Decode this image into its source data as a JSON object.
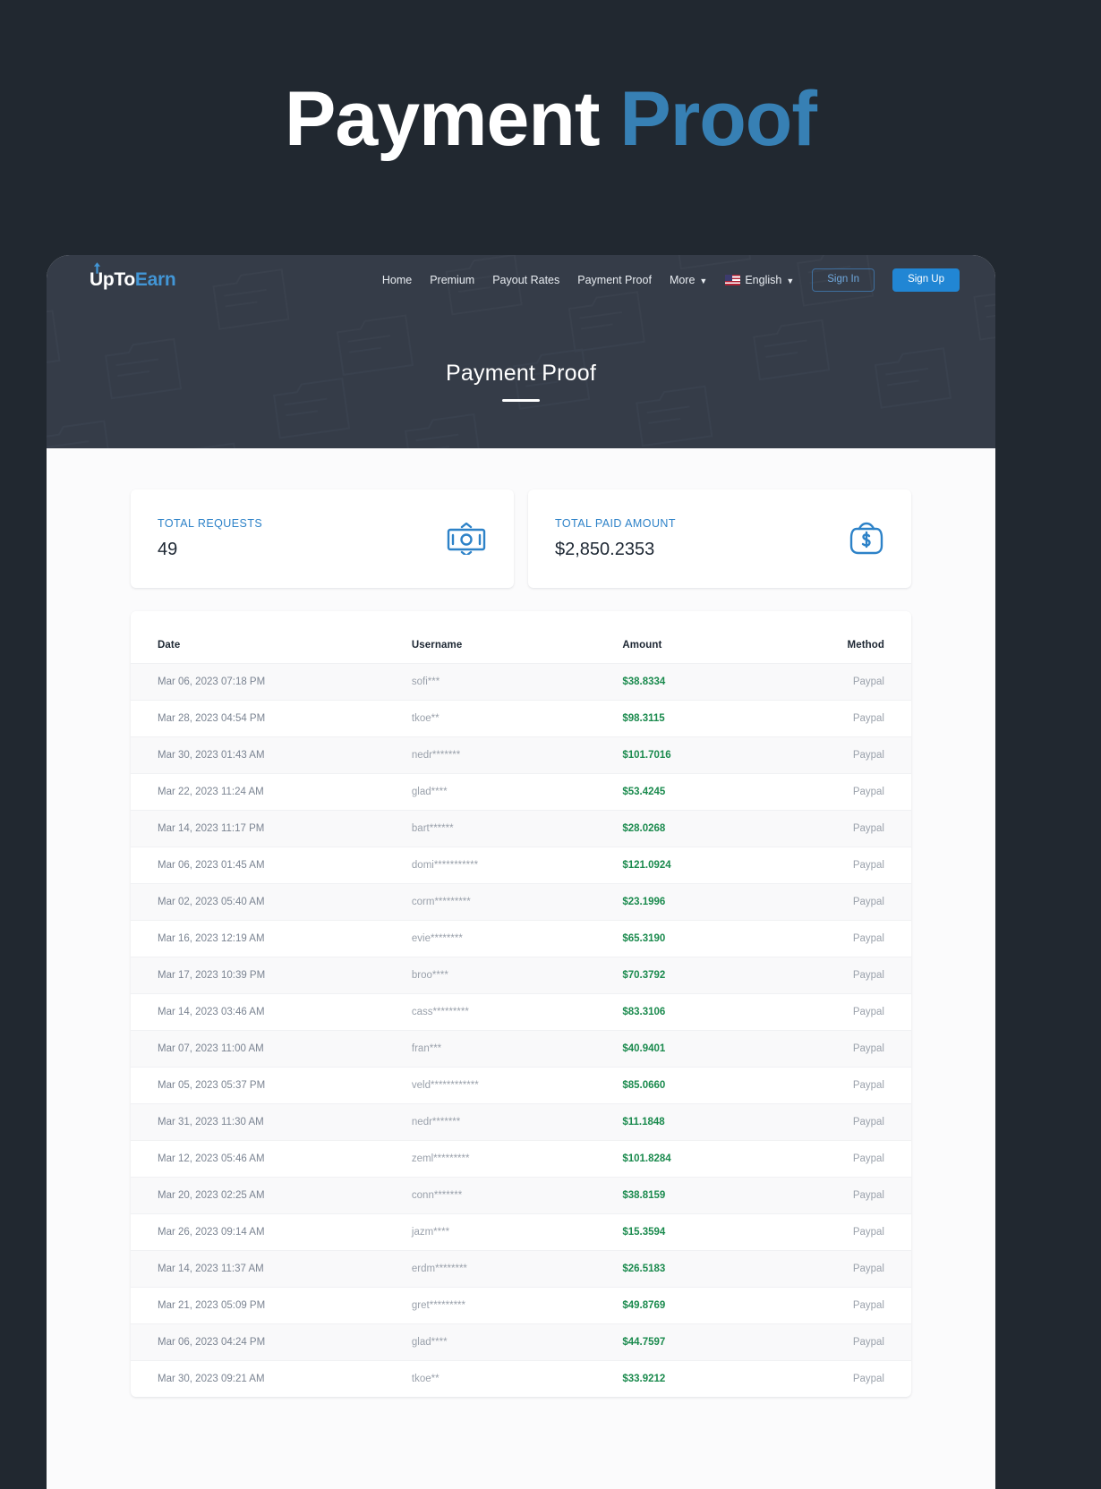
{
  "hero": {
    "word1": "Payment",
    "word2": "Proof"
  },
  "brand": {
    "part1": "UpTo",
    "part2": "Earn",
    "arrow_icon": "up-arrow-icon"
  },
  "nav": {
    "links": [
      {
        "label": "Home"
      },
      {
        "label": "Premium"
      },
      {
        "label": "Payout Rates"
      },
      {
        "label": "Payment Proof"
      }
    ],
    "more_label": "More",
    "language_label": "English",
    "flag_icon": "us-flag-icon",
    "chevron_icon": "chevron-down-icon",
    "sign_in_label": "Sign In",
    "sign_up_label": "Sign Up"
  },
  "page_header": {
    "title": "Payment Proof"
  },
  "stats": [
    {
      "label": "TOTAL REQUESTS",
      "value": "49",
      "icon": "banknote-check-icon"
    },
    {
      "label": "TOTAL PAID AMOUNT",
      "value": "$2,850.2353",
      "icon": "money-bag-dollar-icon"
    }
  ],
  "table": {
    "columns": [
      "Date",
      "Username",
      "Amount",
      "Method"
    ],
    "rows": [
      {
        "date": "Mar 06, 2023 07:18 PM",
        "username": "sofi***",
        "amount": "$38.8334",
        "method": "Paypal"
      },
      {
        "date": "Mar 28, 2023 04:54 PM",
        "username": "tkoe**",
        "amount": "$98.3115",
        "method": "Paypal"
      },
      {
        "date": "Mar 30, 2023 01:43 AM",
        "username": "nedr*******",
        "amount": "$101.7016",
        "method": "Paypal"
      },
      {
        "date": "Mar 22, 2023 11:24 AM",
        "username": "glad****",
        "amount": "$53.4245",
        "method": "Paypal"
      },
      {
        "date": "Mar 14, 2023 11:17 PM",
        "username": "bart******",
        "amount": "$28.0268",
        "method": "Paypal"
      },
      {
        "date": "Mar 06, 2023 01:45 AM",
        "username": "domi***********",
        "amount": "$121.0924",
        "method": "Paypal"
      },
      {
        "date": "Mar 02, 2023 05:40 AM",
        "username": "corm*********",
        "amount": "$23.1996",
        "method": "Paypal"
      },
      {
        "date": "Mar 16, 2023 12:19 AM",
        "username": "evie********",
        "amount": "$65.3190",
        "method": "Paypal"
      },
      {
        "date": "Mar 17, 2023 10:39 PM",
        "username": "broo****",
        "amount": "$70.3792",
        "method": "Paypal"
      },
      {
        "date": "Mar 14, 2023 03:46 AM",
        "username": "cass*********",
        "amount": "$83.3106",
        "method": "Paypal"
      },
      {
        "date": "Mar 07, 2023 11:00 AM",
        "username": "fran***",
        "amount": "$40.9401",
        "method": "Paypal"
      },
      {
        "date": "Mar 05, 2023 05:37 PM",
        "username": "veld************",
        "amount": "$85.0660",
        "method": "Paypal"
      },
      {
        "date": "Mar 31, 2023 11:30 AM",
        "username": "nedr*******",
        "amount": "$11.1848",
        "method": "Paypal"
      },
      {
        "date": "Mar 12, 2023 05:46 AM",
        "username": "zeml*********",
        "amount": "$101.8284",
        "method": "Paypal"
      },
      {
        "date": "Mar 20, 2023 02:25 AM",
        "username": "conn*******",
        "amount": "$38.8159",
        "method": "Paypal"
      },
      {
        "date": "Mar 26, 2023 09:14 AM",
        "username": "jazm****",
        "amount": "$15.3594",
        "method": "Paypal"
      },
      {
        "date": "Mar 14, 2023 11:37 AM",
        "username": "erdm********",
        "amount": "$26.5183",
        "method": "Paypal"
      },
      {
        "date": "Mar 21, 2023 05:09 PM",
        "username": "gret*********",
        "amount": "$49.8769",
        "method": "Paypal"
      },
      {
        "date": "Mar 06, 2023 04:24 PM",
        "username": "glad****",
        "amount": "$44.7597",
        "method": "Paypal"
      },
      {
        "date": "Mar 30, 2023 09:21 AM",
        "username": "tkoe**",
        "amount": "$33.9212",
        "method": "Paypal"
      }
    ]
  },
  "colors": {
    "page_bg": "#212830",
    "accent_blue": "#3780b4",
    "brand_blue": "#4296d6",
    "header_bg": "#353c48",
    "amount_green": "#1a8a4d",
    "stat_label_blue": "#2d82c8"
  }
}
